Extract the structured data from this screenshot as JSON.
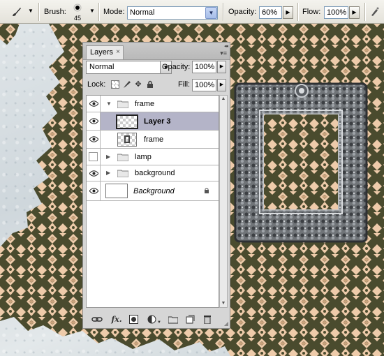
{
  "toolbar": {
    "tool_icon": "brush-tool-icon",
    "brush_label": "Brush:",
    "brush_size": "45",
    "mode_label": "Mode:",
    "mode_value": "Normal",
    "opacity_label": "Opacity:",
    "opacity_value": "60%",
    "flow_label": "Flow:",
    "flow_value": "100%"
  },
  "layers_panel": {
    "tab_label": "Layers",
    "close_glyph": "×",
    "blend_mode": "Normal",
    "opacity_label": "Opacity:",
    "opacity_value": "100%",
    "lock_label": "Lock:",
    "fill_label": "Fill:",
    "fill_value": "100%",
    "layers": [
      {
        "name": "frame",
        "type": "group",
        "visible": true,
        "expanded": true
      },
      {
        "name": "Layer 3",
        "type": "layer",
        "visible": true,
        "selected": true,
        "indent": true
      },
      {
        "name": "frame",
        "type": "layer",
        "visible": true,
        "indent": true
      },
      {
        "name": "lamp",
        "type": "group",
        "visible": false,
        "expanded": false
      },
      {
        "name": "background",
        "type": "group",
        "visible": true,
        "expanded": false
      },
      {
        "name": "Background",
        "type": "background",
        "visible": true,
        "locked": true
      }
    ],
    "bottom_icons": [
      "link-icon",
      "fx-icon",
      "mask-icon",
      "adjustment-icon",
      "new-group-icon",
      "new-layer-icon",
      "trash-icon"
    ],
    "fx_label": "fx."
  },
  "colors": {
    "damask_light": "#eecbaa",
    "damask_dark": "#4a4b2e",
    "wall": "#d8dfe3",
    "frame_metal": "#6f7378",
    "selected_row": "#b4b4c8"
  }
}
